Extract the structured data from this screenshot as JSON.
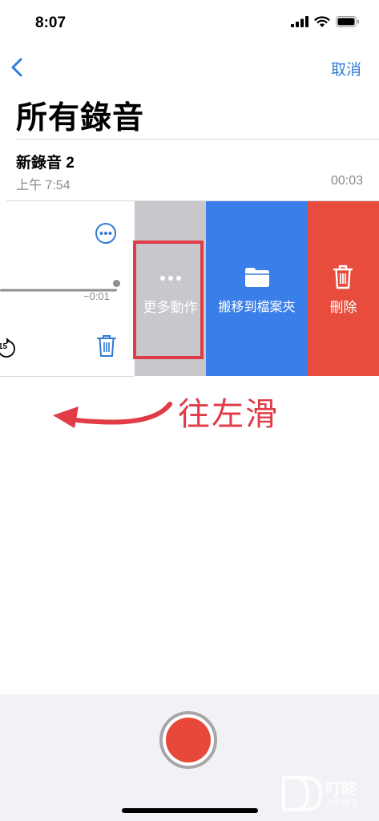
{
  "status_bar": {
    "time": "8:07"
  },
  "nav": {
    "cancel_label": "取消"
  },
  "page": {
    "title": "所有錄音"
  },
  "recording": {
    "name": "新錄音 2",
    "time": "上午 7:54",
    "duration": "00:03",
    "remaining": "−0:01",
    "skip_label": "15",
    "progress": 1.0
  },
  "actions": {
    "more_label": "更多動作",
    "move_label": "搬移到檔案夾",
    "delete_label": "刪除"
  },
  "annotation": {
    "text": "往左滑"
  },
  "watermark": {
    "cn": "叮咚",
    "en": "NEWS"
  },
  "colors": {
    "accent": "#2f7cd6",
    "more": "#c8c7cc",
    "move": "#3a7fe9",
    "delete": "#e74c3c",
    "annotation": "#e03b47",
    "record": "#e8483a"
  }
}
